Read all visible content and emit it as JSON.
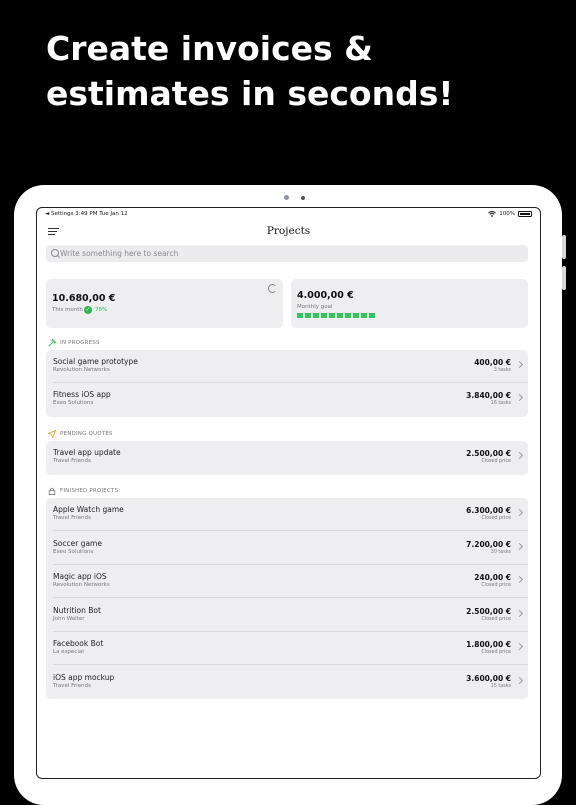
{
  "headline": "Create invoices & estimates in seconds!",
  "status": {
    "left": "◄ Settings   3:49 PM   Tue Jan 12",
    "battery": "100%"
  },
  "nav": {
    "title": "Projects"
  },
  "search": {
    "placeholder": "Write something here to search"
  },
  "cards": {
    "month": {
      "amount": "10.680,00 €",
      "label": "This month",
      "percent": "78%"
    },
    "goal": {
      "amount": "4.000,00 €",
      "label": "Monthly goal",
      "progress_fraction": 1.0
    }
  },
  "sections": {
    "in_progress": "IN PROGRESS",
    "pending": "PENDING QUOTES",
    "finished": "FINISHED PROJECTS"
  },
  "in_progress": [
    {
      "name": "Social game prototype",
      "client": "Revolution Networks",
      "price": "400,00 €",
      "detail": "3 tasks"
    },
    {
      "name": "Fitness iOS app",
      "client": "Exeo Solutions",
      "price": "3.840,00 €",
      "detail": "16 tasks"
    }
  ],
  "pending": [
    {
      "name": "Travel app update",
      "client": "Travel Friends",
      "price": "2.500,00 €",
      "detail": "Closed price"
    }
  ],
  "finished": [
    {
      "name": "Apple Watch game",
      "client": "Travel Friends",
      "price": "6.300,00 €",
      "detail": "Closed price"
    },
    {
      "name": "Soccer game",
      "client": "Exeo Solutions",
      "price": "7.200,00 €",
      "detail": "30 tasks"
    },
    {
      "name": "Magic app iOS",
      "client": "Revolution Networks",
      "price": "240,00 €",
      "detail": "Closed price"
    },
    {
      "name": "Nutrition Bot",
      "client": "John Walter",
      "price": "2.500,00 €",
      "detail": "Closed price"
    },
    {
      "name": "Facebook Bot",
      "client": "La especial",
      "price": "1.800,00 €",
      "detail": "Closed price"
    },
    {
      "name": "iOS app mockup",
      "client": "Travel Friends",
      "price": "3.600,00 €",
      "detail": "15 tasks"
    }
  ],
  "colors": {
    "accent_green": "#2ec45a",
    "card_bg": "#eeeef1",
    "background": "#000000"
  },
  "icons": [
    "menu-icon",
    "search-icon",
    "refresh-icon",
    "check-icon",
    "hammer-icon",
    "paper-plane-icon",
    "lock-icon",
    "chevron-right-icon",
    "wifi-icon",
    "battery-icon"
  ]
}
